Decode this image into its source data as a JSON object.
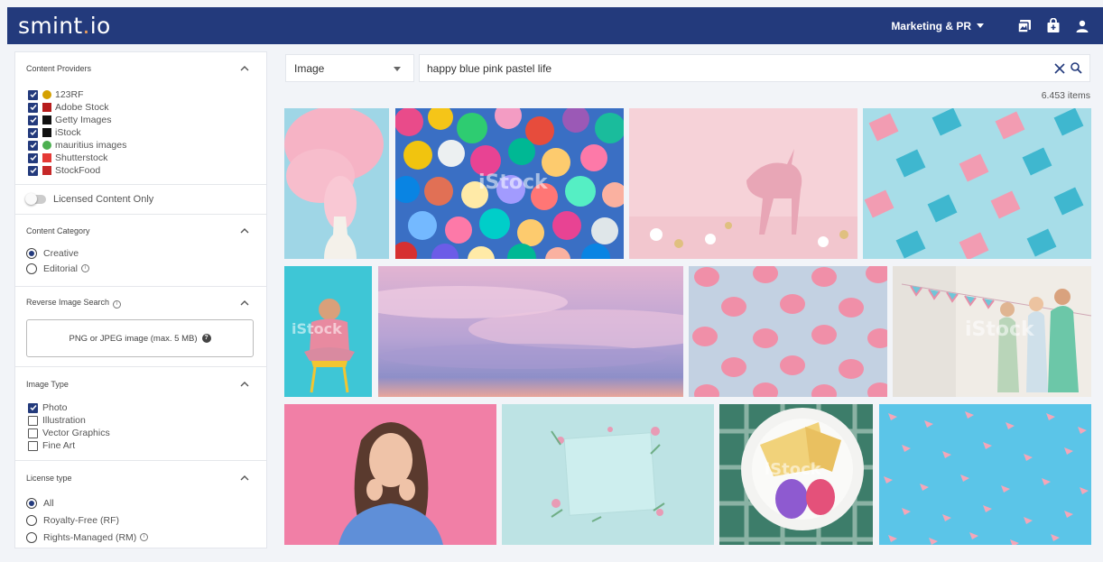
{
  "app": {
    "logo_text": "smint",
    "logo_dot": ".",
    "logo_suffix": "io"
  },
  "header": {
    "workspace": "Marketing & PR",
    "icons": [
      "gallery-icon",
      "shopping-bag-icon",
      "user-icon"
    ]
  },
  "search": {
    "type": "Image",
    "query": "happy blue pink pastel life",
    "result_count": "6.453 items"
  },
  "sidebar": {
    "providers": {
      "title": "Content Providers",
      "items": [
        {
          "label": "123RF",
          "checked": true,
          "color": "#d4a000"
        },
        {
          "label": "Adobe Stock",
          "checked": true,
          "color": "#b71c1c"
        },
        {
          "label": "Getty Images",
          "checked": true,
          "color": "#111111"
        },
        {
          "label": "iStock",
          "checked": true,
          "color": "#111111"
        },
        {
          "label": "mauritius images",
          "checked": true,
          "color": "#4caf50"
        },
        {
          "label": "Shutterstock",
          "checked": true,
          "color": "#e53935"
        },
        {
          "label": "StockFood",
          "checked": true,
          "color": "#c62828"
        }
      ]
    },
    "licensed_only": {
      "label": "Licensed Content Only",
      "on": false
    },
    "category": {
      "title": "Content Category",
      "options": [
        "Creative",
        "Editorial"
      ],
      "selected": "Creative"
    },
    "reverse_search": {
      "title": "Reverse Image Search",
      "upload_label": "PNG or JPEG image (max. 5 MB)"
    },
    "image_type": {
      "title": "Image Type",
      "items": [
        {
          "label": "Photo",
          "checked": true
        },
        {
          "label": "Illustration",
          "checked": false
        },
        {
          "label": "Vector Graphics",
          "checked": false
        },
        {
          "label": "Fine Art",
          "checked": false
        }
      ]
    },
    "license_type": {
      "title": "License type",
      "options": [
        "All",
        "Royalty-Free (RF)",
        "Rights-Managed (RM)"
      ],
      "selected": "All"
    }
  },
  "results": {
    "watermark": "iStock",
    "thumbs": [
      {
        "name": "champagne-pink-smoke"
      },
      {
        "name": "colorful-balloons"
      },
      {
        "name": "pink-unicorn-figurine"
      },
      {
        "name": "pink-blue-gift-boxes"
      },
      {
        "name": "woman-on-yellow-chair"
      },
      {
        "name": "pastel-sky-clouds"
      },
      {
        "name": "pink-pumpkins-pattern"
      },
      {
        "name": "baby-shower-women"
      },
      {
        "name": "smiling-woman-pink-background"
      },
      {
        "name": "flower-frame-pastel"
      },
      {
        "name": "easter-eggs-cake-plate"
      },
      {
        "name": "pink-paper-planes-pattern"
      }
    ]
  },
  "colors": {
    "brand": "#233a7c",
    "accent": "#f0a05a",
    "page_bg": "#f2f4f8"
  }
}
